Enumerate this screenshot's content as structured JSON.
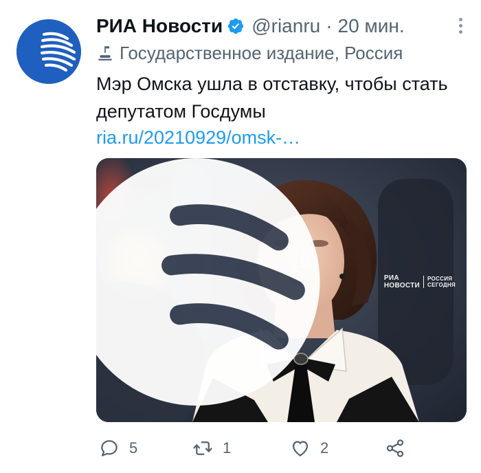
{
  "tweet": {
    "author_name": "РИА Новости",
    "handle": "@rianru",
    "separator": "·",
    "time": "20 мин.",
    "label": "Государственное издание, Россия",
    "text": "Мэр Омска ушла в отставку, чтобы стать депутатом Госдумы",
    "link": "ria.ru/20210929/omsk-…"
  },
  "media": {
    "watermark_left": [
      "РИА",
      "НОВОСТИ"
    ],
    "watermark_right": [
      "РОССИЯ",
      "СЕГОДНЯ"
    ]
  },
  "actions": {
    "replies": "5",
    "retweets": "1",
    "likes": "2"
  },
  "colors": {
    "accent": "#1d9bf0",
    "verified": "#1d9bf0",
    "muted": "#536471",
    "avatar_bg": "#1f5fbf"
  },
  "icons": {
    "avatar": "ria-logo-icon",
    "verified": "verified-badge-icon",
    "label": "government-building-icon",
    "more": "more-options-icon",
    "reply": "reply-icon",
    "retweet": "retweet-icon",
    "like": "heart-icon",
    "share": "share-icon"
  }
}
